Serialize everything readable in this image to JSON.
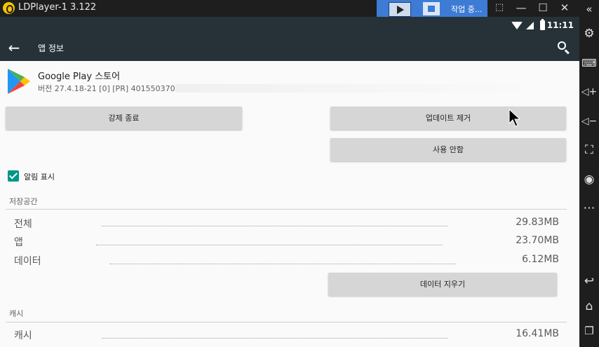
{
  "window": {
    "title": "LDPlayer-1 3.122",
    "recording_status": "작업 중..."
  },
  "statusbar": {
    "clock": "11:11"
  },
  "appbar": {
    "title": "앱 정보"
  },
  "app": {
    "name": "Google Play 스토어",
    "version": "버전 27.4.18-21 [0] [PR] 401550370"
  },
  "buttons": {
    "force_stop": "강제 종료",
    "remove_updates": "업데이트 제거",
    "disable": "사용 안함",
    "clear_data": "데이터 지우기"
  },
  "notifications": {
    "label": "알림 표시",
    "checked": true
  },
  "storage": {
    "section_title": "저장공간",
    "rows": [
      {
        "label": "전체",
        "value": "29.83MB"
      },
      {
        "label": "앱",
        "value": "23.70MB"
      },
      {
        "label": "데이터",
        "value": "6.12MB"
      }
    ]
  },
  "cache": {
    "section_title": "캐시",
    "rows": [
      {
        "label": "캐시",
        "value": "16.41MB"
      }
    ]
  },
  "icons": {
    "titlebar": [
      "app-logo",
      "play",
      "stop",
      "sync",
      "minimize",
      "maximize",
      "close",
      "collapse-sidebar"
    ],
    "sidebar": [
      "settings",
      "keyboard",
      "volume-up",
      "volume-down",
      "screenshot",
      "record",
      "more",
      "back",
      "home",
      "recents"
    ]
  },
  "colors": {
    "appbar": "#263238",
    "checkbox": "#009688",
    "rec_panel": "#3d7bd5"
  }
}
